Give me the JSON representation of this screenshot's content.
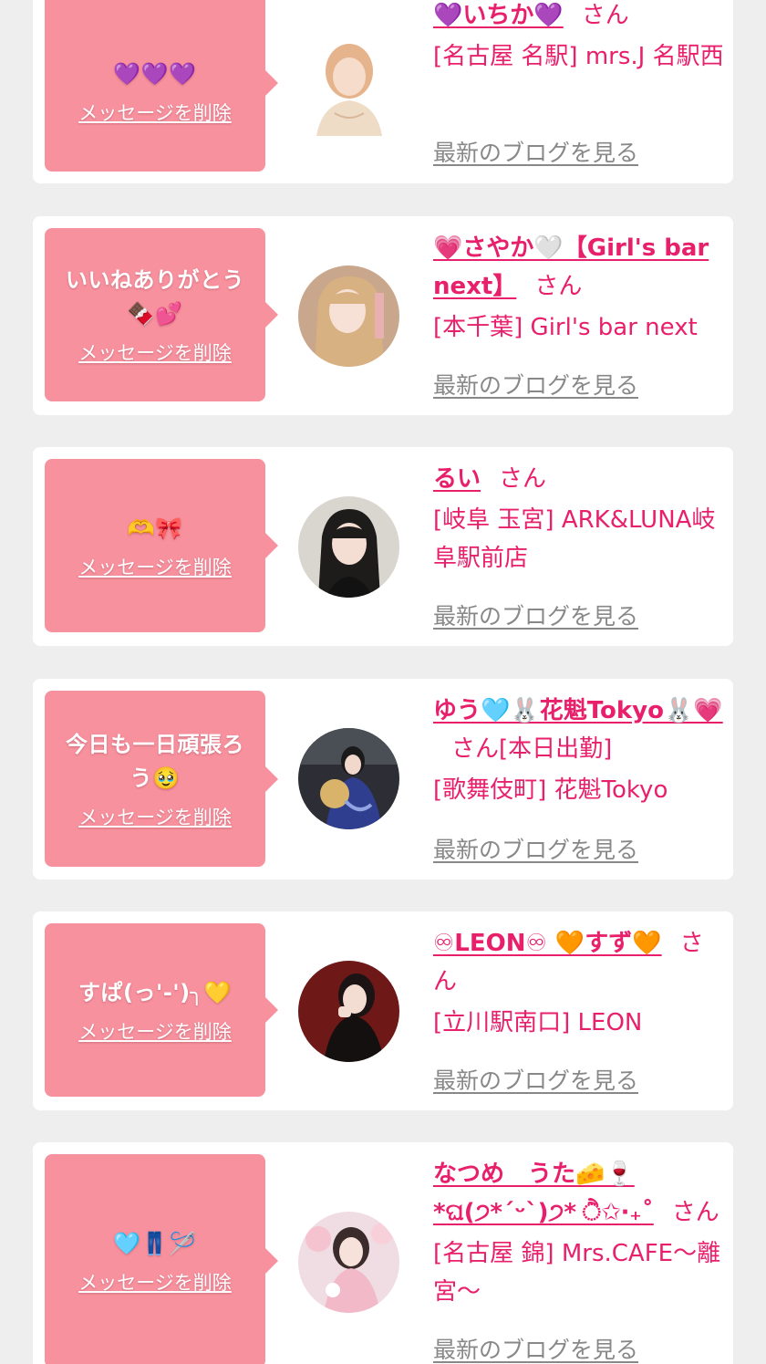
{
  "delete_label": "メッセージを削除",
  "san_label": "さん",
  "blog_label": "最新のブログを見る",
  "cards": [
    {
      "message": "💜💜💜",
      "name": "💜いちか💜",
      "shop": "[名古屋 名駅] mrs.J 名駅西",
      "avatar_bg": "#f3e3d8"
    },
    {
      "message": "いいねありがとう🍫💕",
      "name": "💗さやか🤍【Girl's bar next】",
      "shop": "[本千葉] Girl's bar next",
      "avatar_bg": "#c9a78d"
    },
    {
      "message": "🫶🎀",
      "name": "るい",
      "shop": "[岐阜 玉宮] ARK&LUNA岐阜駅前店",
      "avatar_bg": "#d9d6d0"
    },
    {
      "message": "今日も一日頑張ろう🥹",
      "name": "ゆう🩵🐰花魁Tokyo🐰💗",
      "extra": "[本日出勤]",
      "shop": "[歌舞伎町] 花魁Tokyo",
      "avatar_bg": "#3d3f6e"
    },
    {
      "message": "すぱ(っ'-')╮💛",
      "name": "♾LEON♾ 🧡すず🧡",
      "shop": "[立川駅南口] LEON",
      "avatar_bg": "#6e1818"
    },
    {
      "message": "🩵👖🪡",
      "name": "なつめ　うた🧀🍷*ଘ(੭*ˊᵕˋ)੭* ੈ✩‧₊˚",
      "shop": "[名古屋 錦] Mrs.CAFE〜離宮〜",
      "avatar_bg": "#f0dde3"
    }
  ]
}
